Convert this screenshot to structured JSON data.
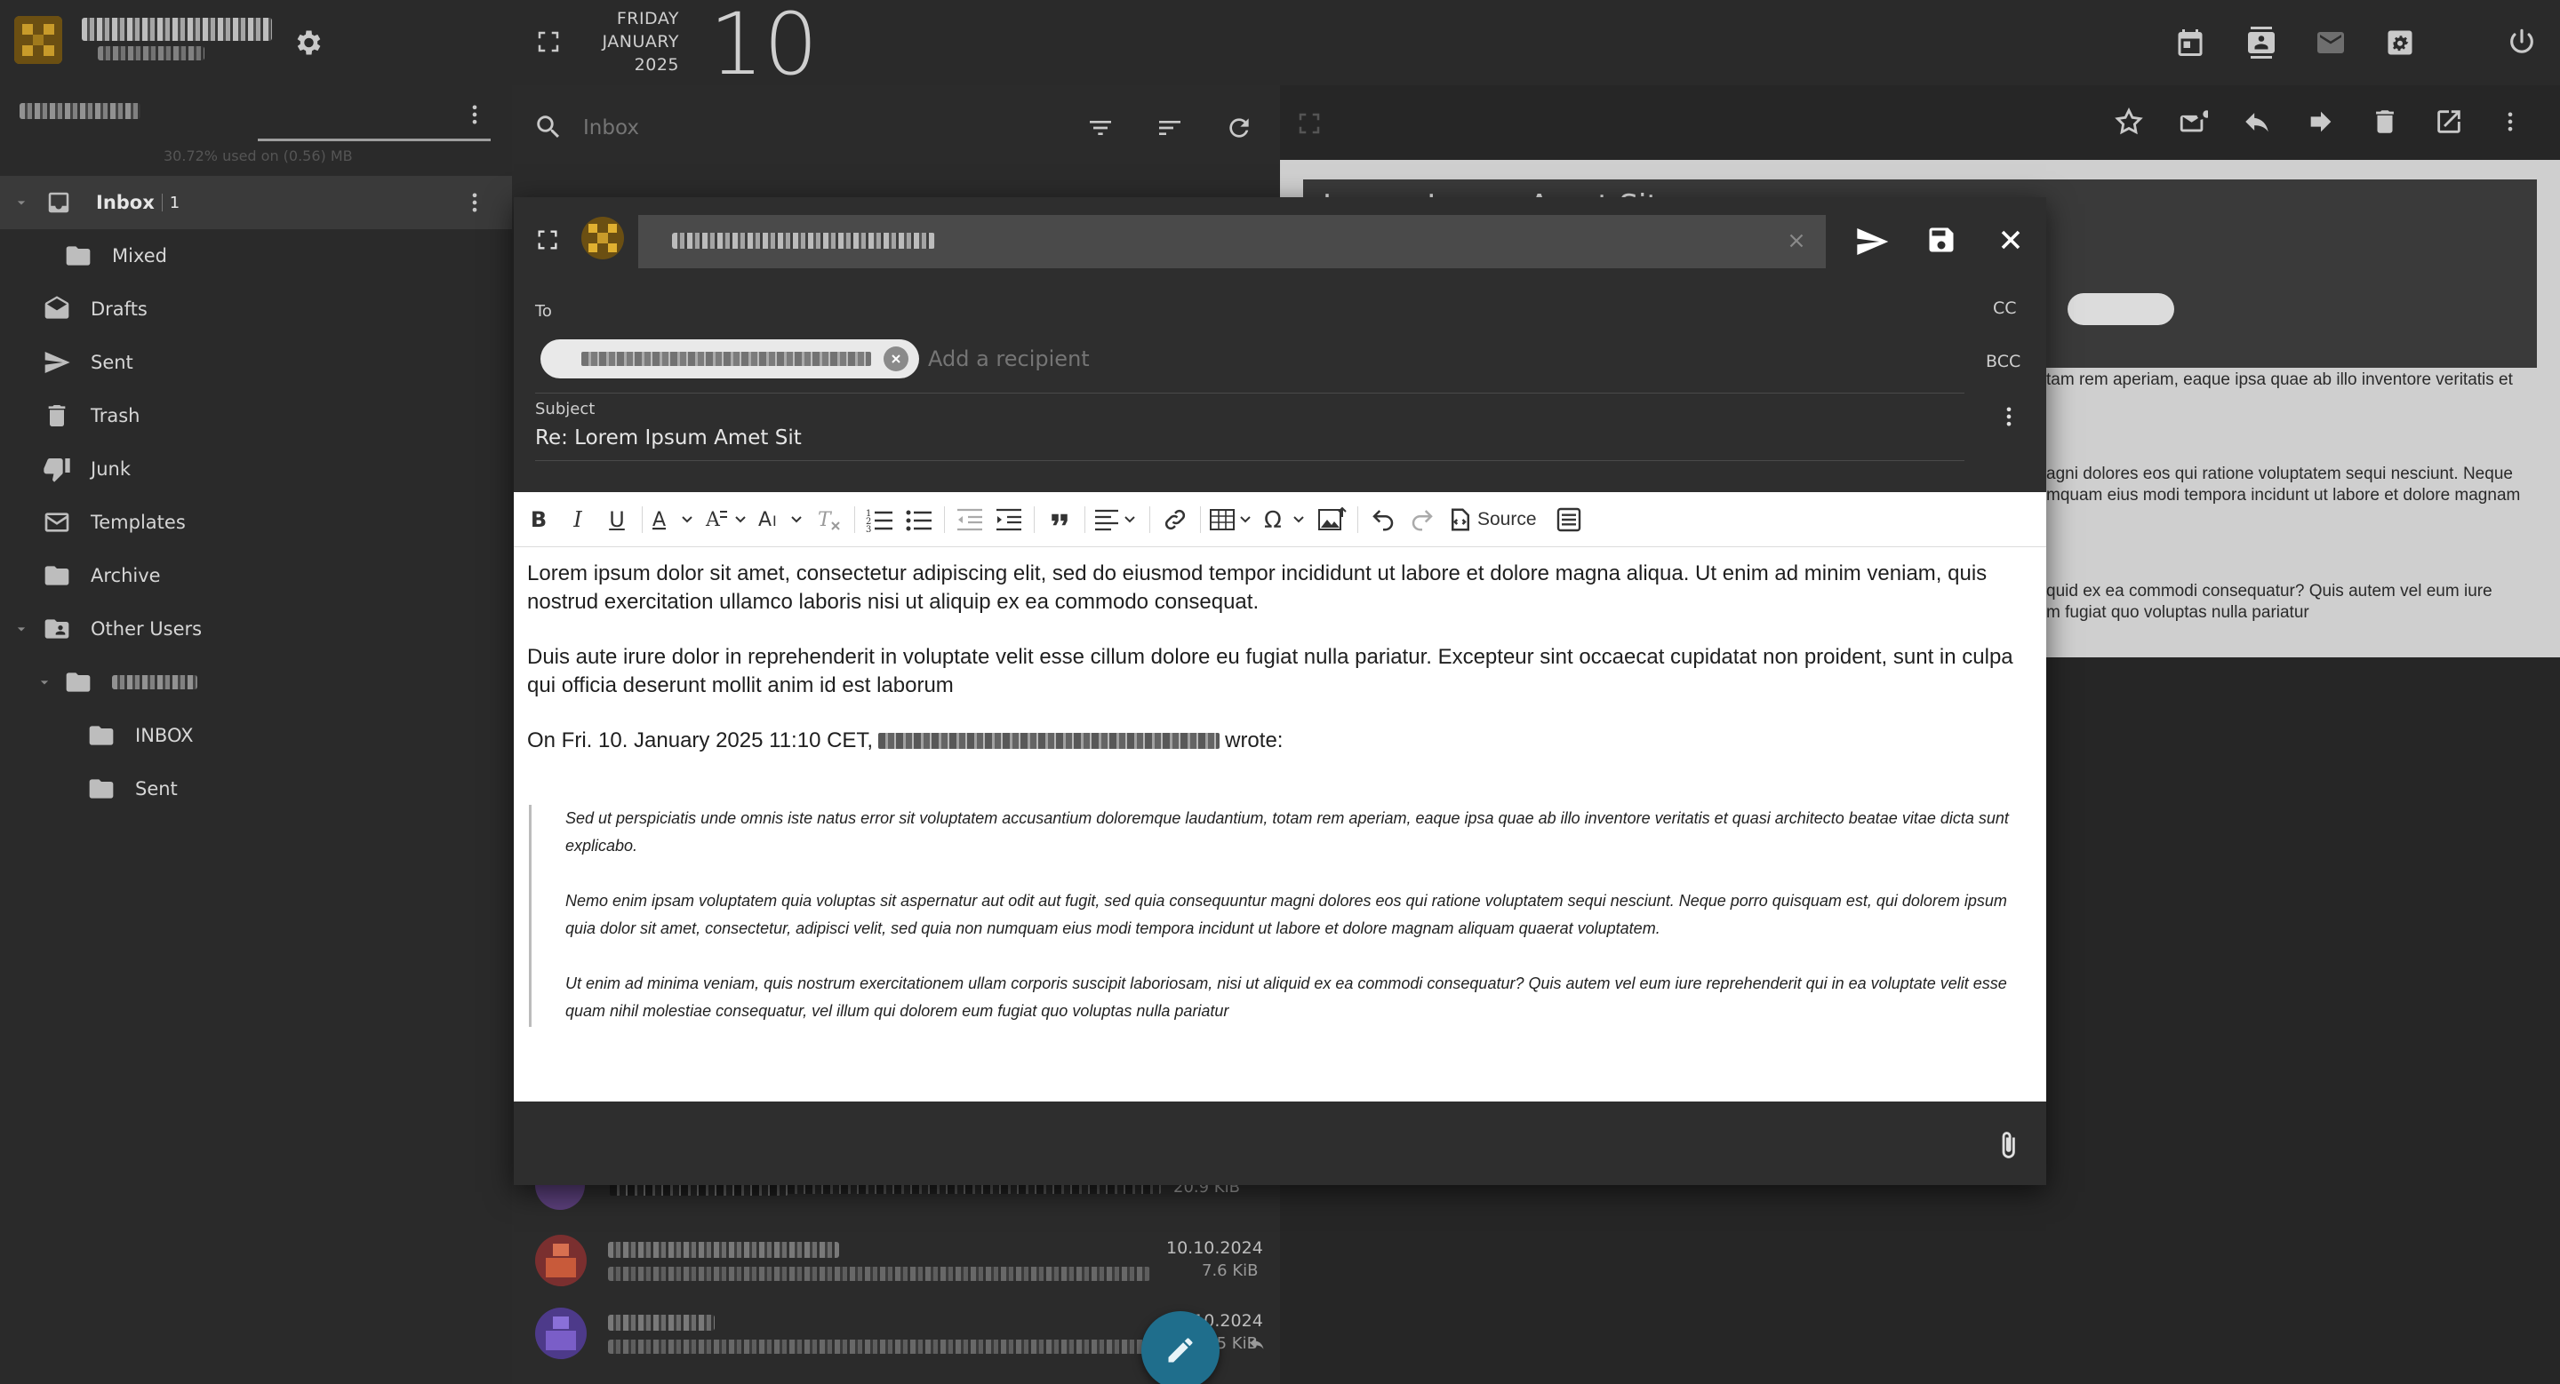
{
  "header": {
    "day_of_week": "FRIDAY",
    "month": "JANUARY",
    "year": "2025",
    "day_number": "10"
  },
  "sidebar": {
    "quota_text": "30.72% used on (0.56) MB",
    "folders": [
      {
        "label": "Inbox",
        "count": "1",
        "icon": "inbox-icon"
      },
      {
        "label": "Mixed",
        "icon": "folder-icon"
      },
      {
        "label": "Drafts",
        "icon": "drafts-icon"
      },
      {
        "label": "Sent",
        "icon": "sent-icon"
      },
      {
        "label": "Trash",
        "icon": "trash-icon"
      },
      {
        "label": "Junk",
        "icon": "junk-icon"
      },
      {
        "label": "Templates",
        "icon": "templates-icon"
      },
      {
        "label": "Archive",
        "icon": "folder-icon"
      },
      {
        "label": "Other Users",
        "icon": "shared-folder-icon"
      },
      {
        "label": "INBOX",
        "icon": "folder-icon"
      },
      {
        "label": "Sent",
        "icon": "folder-icon"
      }
    ]
  },
  "list": {
    "search_placeholder": "Inbox",
    "rows": [
      {
        "date": "",
        "size": "20.9 KiB"
      },
      {
        "date": "10.10.2024",
        "size": "7.6 KiB"
      },
      {
        "date": "10.10.2024",
        "size": "22.5 KiB"
      }
    ]
  },
  "reading": {
    "title": "Lorem Ipsum Amet Sit",
    "snippets": [
      "tam rem aperiam, eaque ipsa quae ab illo inventore veritatis et",
      "agni dolores eos qui ratione voluptatem sequi nesciunt. Neque",
      "mquam eius modi tempora incidunt ut labore et dolore magnam",
      "quid ex ea commodi consequatur? Quis autem vel eum iure",
      "m fugiat quo voluptas nulla pariatur"
    ]
  },
  "composer": {
    "to_label": "To",
    "cc_label": "CC",
    "bcc_label": "BCC",
    "add_recipient_placeholder": "Add a recipient",
    "subject_label": "Subject",
    "subject_value": "Re: Lorem Ipsum Amet Sit",
    "source_label": "Source",
    "body": {
      "p1": "Lorem ipsum dolor sit amet, consectetur adipiscing elit, sed do eiusmod tempor incididunt ut labore et dolore magna aliqua. Ut enim ad minim veniam, quis nostrud exercitation ullamco laboris nisi ut aliquip ex ea commodo consequat.",
      "p2": "Duis aute irure dolor in reprehenderit in voluptate velit esse cillum dolore eu fugiat nulla pariatur. Excepteur sint occaecat cupidatat non proident, sunt in culpa qui officia deserunt mollit anim id est laborum",
      "quote_intro_prefix": "On Fri. 10. January 2025 11:10 CET,",
      "quote_intro_suffix": "wrote:",
      "q1": "Sed ut perspiciatis unde omnis iste natus error sit voluptatem accusantium doloremque laudantium, totam rem aperiam, eaque ipsa quae ab illo inventore veritatis et quasi architecto beatae vitae dicta sunt explicabo.",
      "q2": "Nemo enim ipsam voluptatem quia voluptas sit aspernatur aut odit aut fugit, sed quia consequuntur magni dolores eos qui ratione voluptatem sequi nesciunt. Neque porro quisquam est, qui dolorem ipsum quia dolor sit amet, consectetur, adipisci velit, sed quia non numquam eius modi tempora incidunt ut labore et dolore magnam aliquam quaerat voluptatem.",
      "q3": "Ut enim ad minima veniam, quis nostrum exercitationem ullam corporis suscipit laboriosam, nisi ut aliquid ex ea commodi consequatur? Quis autem vel eum iure reprehenderit qui in ea voluptate velit esse quam nihil molestiae consequatur, vel illum qui dolorem eum fugiat quo voluptas nulla pariatur"
    }
  },
  "colors": {
    "background": "#262626",
    "panel": "#2a2a2a",
    "fab": "#1f6e8c",
    "editor_bg": "#ffffff"
  }
}
